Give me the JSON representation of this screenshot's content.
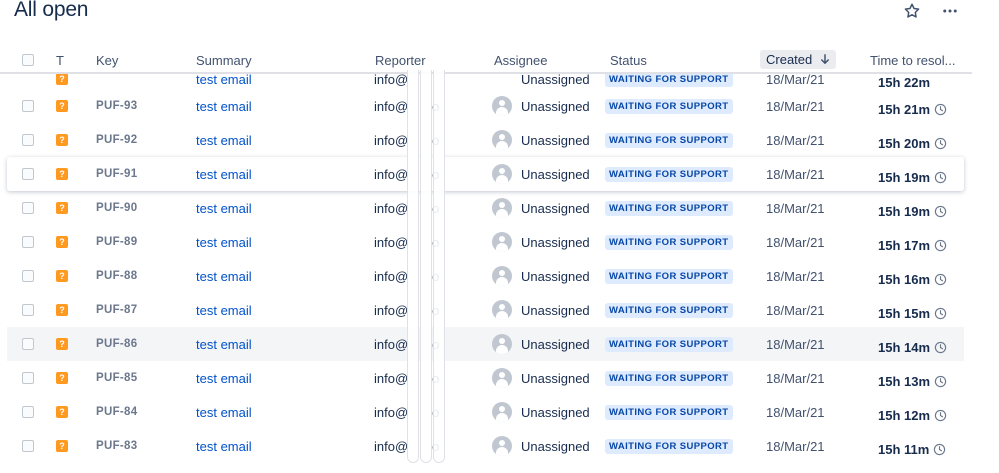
{
  "header": {
    "title": "All open"
  },
  "columns": {
    "type": "T",
    "key": "Key",
    "summary": "Summary",
    "reporter": "Reporter",
    "assignee": "Assignee",
    "status": "Status",
    "created": "Created",
    "time_to_resolution": "Time to resol..."
  },
  "partial_row": {
    "summary": "test email",
    "reporter": "info@",
    "assignee": "Unassigned",
    "status": "WAITING FOR SUPPORT",
    "created": "18/Mar/21",
    "time": "15h 22m"
  },
  "rows": [
    {
      "key": "PUF-93",
      "summary": "test email",
      "reporter": "info@",
      "reporter_tail": "o",
      "assignee": "Unassigned",
      "status": "WAITING FOR SUPPORT",
      "created": "18/Mar/21",
      "time": "15h 21m"
    },
    {
      "key": "PUF-92",
      "summary": "test email",
      "reporter": "info@",
      "reporter_tail": "o",
      "assignee": "Unassigned",
      "status": "WAITING FOR SUPPORT",
      "created": "18/Mar/21",
      "time": "15h 20m"
    },
    {
      "key": "PUF-91",
      "summary": "test email",
      "reporter": "info@",
      "reporter_tail": "o",
      "assignee": "Unassigned",
      "status": "WAITING FOR SUPPORT",
      "created": "18/Mar/21",
      "time": "15h 19m"
    },
    {
      "key": "PUF-90",
      "summary": "test email",
      "reporter": "info@",
      "reporter_tail": "o",
      "assignee": "Unassigned",
      "status": "WAITING FOR SUPPORT",
      "created": "18/Mar/21",
      "time": "15h 19m"
    },
    {
      "key": "PUF-89",
      "summary": "test email",
      "reporter": "info@",
      "reporter_tail": "o",
      "assignee": "Unassigned",
      "status": "WAITING FOR SUPPORT",
      "created": "18/Mar/21",
      "time": "15h 17m"
    },
    {
      "key": "PUF-88",
      "summary": "test email",
      "reporter": "info@",
      "reporter_tail": "o",
      "assignee": "Unassigned",
      "status": "WAITING FOR SUPPORT",
      "created": "18/Mar/21",
      "time": "15h 16m"
    },
    {
      "key": "PUF-87",
      "summary": "test email",
      "reporter": "info@",
      "reporter_tail": "o",
      "assignee": "Unassigned",
      "status": "WAITING FOR SUPPORT",
      "created": "18/Mar/21",
      "time": "15h 15m"
    },
    {
      "key": "PUF-86",
      "summary": "test email",
      "reporter": "info@",
      "reporter_tail": "o",
      "assignee": "Unassigned",
      "status": "WAITING FOR SUPPORT",
      "created": "18/Mar/21",
      "time": "15h 14m"
    },
    {
      "key": "PUF-85",
      "summary": "test email",
      "reporter": "info@",
      "reporter_tail": "o",
      "assignee": "Unassigned",
      "status": "WAITING FOR SUPPORT",
      "created": "18/Mar/21",
      "time": "15h 13m"
    },
    {
      "key": "PUF-84",
      "summary": "test email",
      "reporter": "info@",
      "reporter_tail": "o",
      "assignee": "Unassigned",
      "status": "WAITING FOR SUPPORT",
      "created": "18/Mar/21",
      "time": "15h 12m"
    },
    {
      "key": "PUF-83",
      "summary": "test email",
      "reporter": "info@",
      "reporter_tail": "o",
      "assignee": "Unassigned",
      "status": "WAITING FOR SUPPORT",
      "created": "18/Mar/21",
      "time": "15h 11m"
    }
  ],
  "icons": {
    "star": "star-icon",
    "more": "more-icon",
    "sort": "arrow-down-icon",
    "issue_type": "question-icon",
    "clock": "clock-icon"
  },
  "colors": {
    "link": "#0052cc",
    "lozenge_bg": "#deebff",
    "lozenge_text": "#0747a6",
    "issue_type": "#ff991f"
  }
}
